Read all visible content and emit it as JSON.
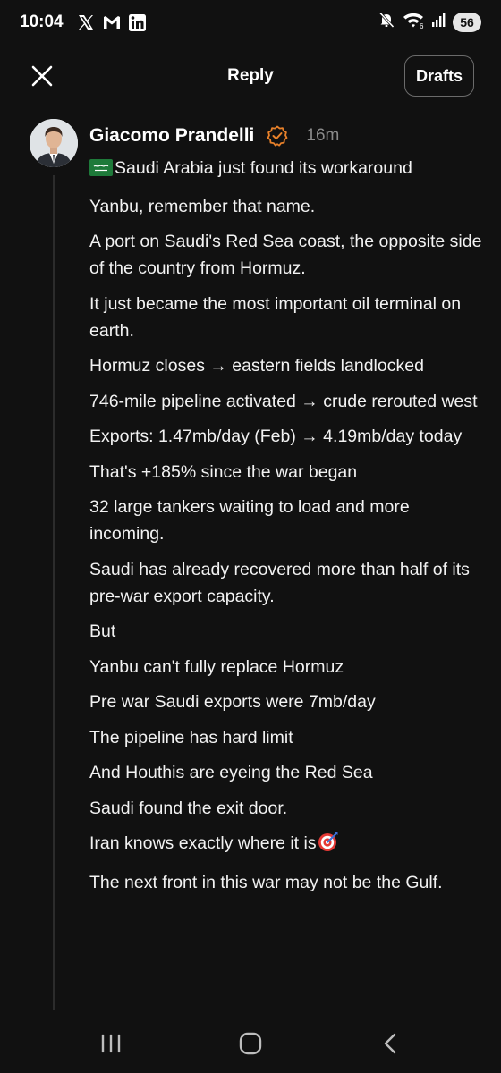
{
  "status_bar": {
    "time": "10:04",
    "app_icons": [
      "x-logo-icon",
      "gmail-icon",
      "linkedin-icon"
    ],
    "system_icons": [
      "mute-icon",
      "wifi-icon",
      "signal-icon"
    ],
    "battery": "56"
  },
  "header": {
    "close_icon": "close-icon",
    "title": "Reply",
    "drafts_label": "Drafts"
  },
  "post": {
    "author": "Giacomo Prandelli",
    "badge_color": "#e8812a",
    "timestamp": "16m",
    "paragraphs": [
      "Saudi Arabia just found its workaround",
      "Yanbu, remember that name.",
      "A port on Saudi's Red Sea coast, the opposite side of the country from Hormuz.",
      "It just became the most important oil terminal on earth.",
      "Hormuz closes → eastern fields landlocked",
      "746-mile pipeline activated → crude rerouted west",
      "Exports: 1.47mb/day (Feb) → 4.19mb/day today",
      "That's +185% since the war began",
      "32 large tankers waiting to load and more incoming.",
      "Saudi has already recovered more than half of its pre-war export capacity.",
      "But",
      "Yanbu can't fully replace Hormuz",
      "Pre war Saudi exports were 7mb/day",
      "The pipeline has hard limit",
      "And Houthis are eyeing the Red Sea",
      "Saudi found the exit door.",
      "Iran knows exactly where it is",
      "The next front in this war may not be the Gulf."
    ]
  },
  "nav_bar": {
    "buttons": [
      "recent-apps-icon",
      "home-icon",
      "back-icon"
    ]
  }
}
